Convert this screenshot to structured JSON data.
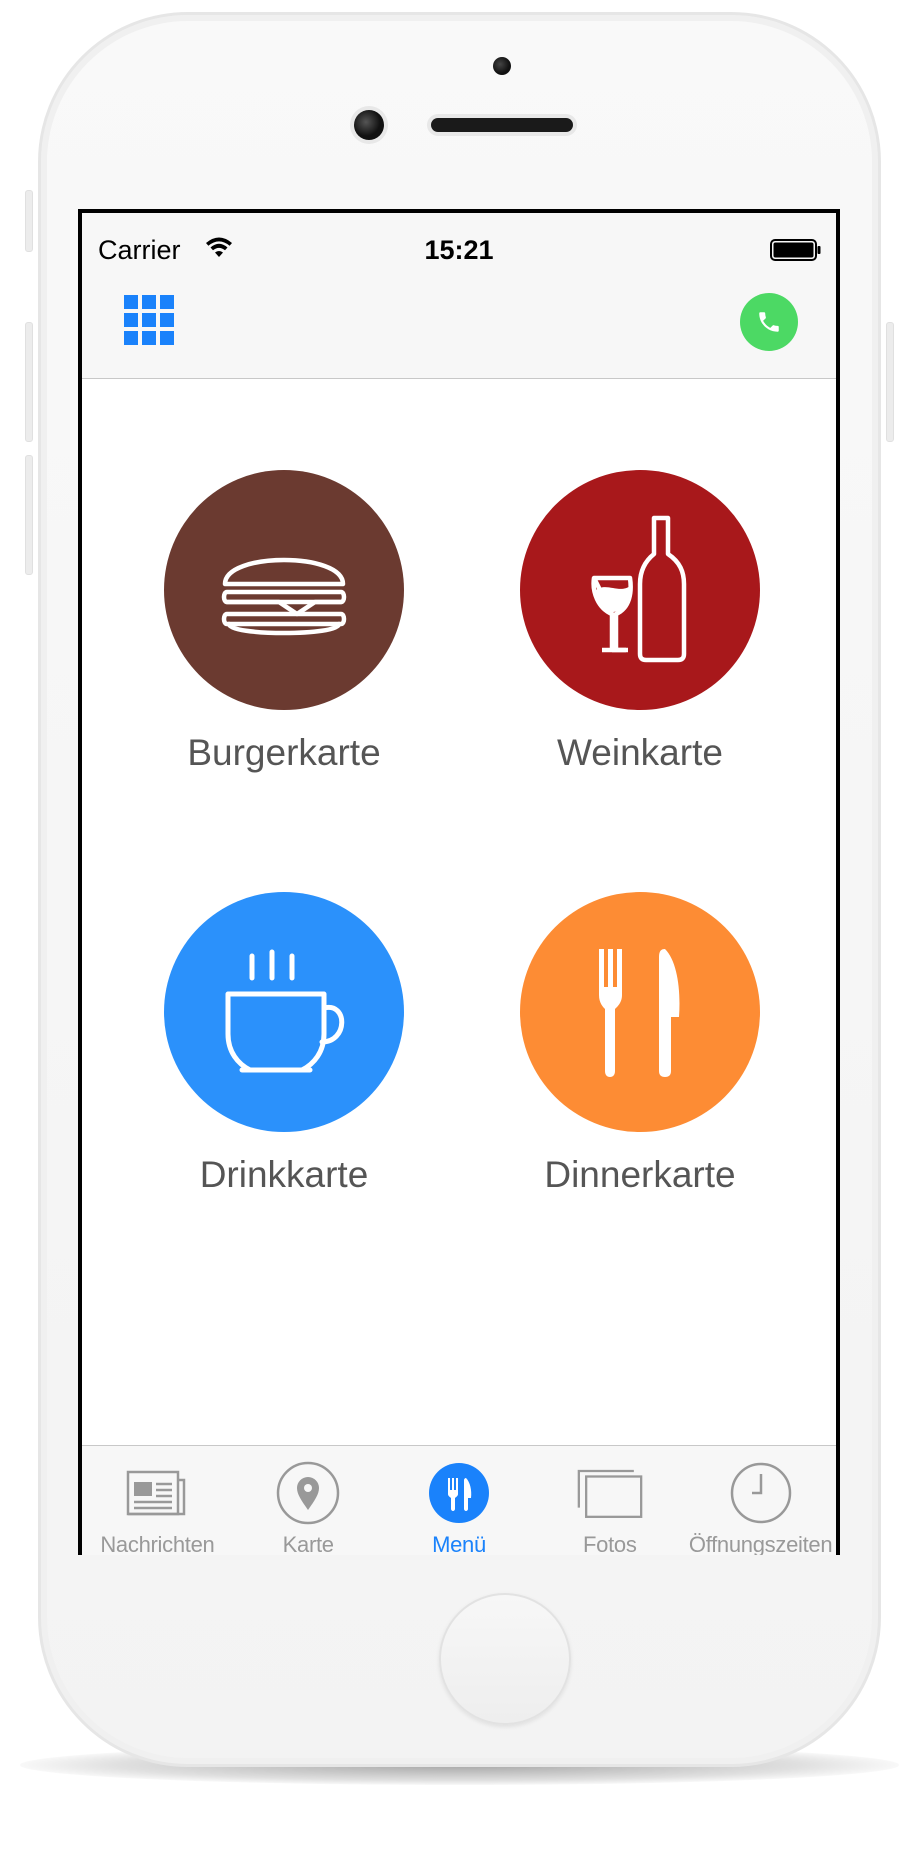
{
  "status_bar": {
    "carrier": "Carrier",
    "time": "15:21",
    "icons": [
      "wifi-icon",
      "battery-icon"
    ]
  },
  "nav_bar": {
    "left_icon": "grid-icon",
    "right_icon": "phone-icon",
    "colors": {
      "grid": "#1a82fb",
      "call": "#4cd964"
    }
  },
  "menu": {
    "items": [
      {
        "label": "Burgerkarte",
        "icon": "burger-icon",
        "color": "#6b3a30"
      },
      {
        "label": "Weinkarte",
        "icon": "wine-icon",
        "color": "#a8181b"
      },
      {
        "label": "Drinkkarte",
        "icon": "coffee-cup-icon",
        "color": "#2b91fb"
      },
      {
        "label": "Dinnerkarte",
        "icon": "cutlery-icon",
        "color": "#fd8c34"
      }
    ]
  },
  "tab_bar": {
    "active_index": 2,
    "active_color": "#1a82fb",
    "inactive_color": "#999999",
    "tabs": [
      {
        "label": "Nachrichten",
        "icon": "news-icon"
      },
      {
        "label": "Karte",
        "icon": "map-pin-icon"
      },
      {
        "label": "Menü",
        "icon": "cutlery-icon"
      },
      {
        "label": "Fotos",
        "icon": "photos-icon"
      },
      {
        "label": "Öffnungszeiten",
        "icon": "clock-icon"
      }
    ]
  }
}
